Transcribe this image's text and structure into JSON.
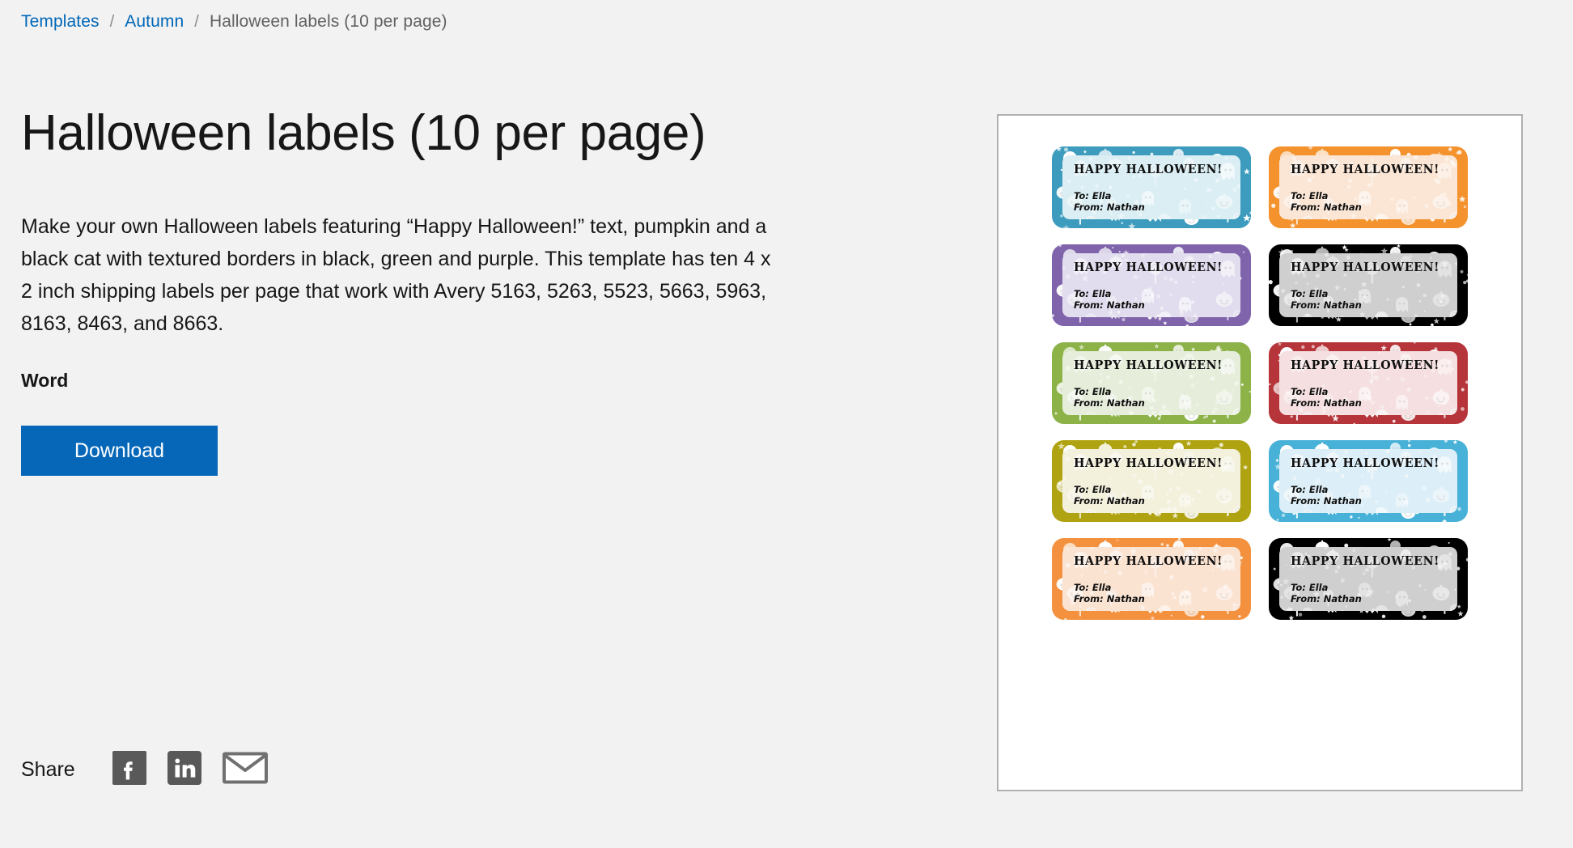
{
  "breadcrumb": {
    "items": [
      {
        "label": "Templates",
        "type": "link"
      },
      {
        "label": "Autumn",
        "type": "link"
      },
      {
        "label": "Halloween labels (10 per page)",
        "type": "current"
      }
    ],
    "separator": "/"
  },
  "main": {
    "title": "Halloween labels (10 per page)",
    "description": "Make your own Halloween labels featuring “Happy Halloween!” text, pumpkin and a black cat with textured borders in black, green and purple. This template has ten 4 x 2 inch shipping labels per page that work with Avery 5163, 5263, 5523, 5663, 5963, 8163, 8463, and 8663.",
    "format_label": "Word",
    "download_label": "Download"
  },
  "share": {
    "label": "Share",
    "icons": [
      {
        "name": "facebook-icon",
        "title": "Facebook"
      },
      {
        "name": "linkedin-icon",
        "title": "LinkedIn"
      },
      {
        "name": "email-icon",
        "title": "Email"
      }
    ]
  },
  "preview": {
    "heading_text": "HAPPY HALLOWEEN!",
    "to_from_text": "To: Ella\nFrom: Nathan",
    "labels": [
      {
        "position": "row1-left",
        "border": "#3d9cbe",
        "inner": "#daeef4"
      },
      {
        "position": "row1-right",
        "border": "#f4922e",
        "inner": "#fbe6d5"
      },
      {
        "position": "row2-left",
        "border": "#7f63ab",
        "inner": "#e2ddee"
      },
      {
        "position": "row2-right",
        "border": "#000000",
        "inner": "#cfcfcf"
      },
      {
        "position": "row3-left",
        "border": "#8cb248",
        "inner": "#e6eedb"
      },
      {
        "position": "row3-right",
        "border": "#b5353a",
        "inner": "#f5dfe0"
      },
      {
        "position": "row4-left",
        "border": "#b0a311",
        "inner": "#f3f0db"
      },
      {
        "position": "row4-right",
        "border": "#48b1d7",
        "inner": "#dceef7"
      },
      {
        "position": "row5-left",
        "border": "#f4913e",
        "inner": "#fbe3d2"
      },
      {
        "position": "row5-right",
        "border": "#000000",
        "inner": "#cfcfcf"
      }
    ]
  },
  "colors": {
    "page_background": "#f2f2f2",
    "link": "#0067b8",
    "text": "#171717",
    "muted_text": "#616161",
    "button": "#0667b8",
    "panel_border": "#b0b0b0",
    "share_icon": "#595959"
  }
}
